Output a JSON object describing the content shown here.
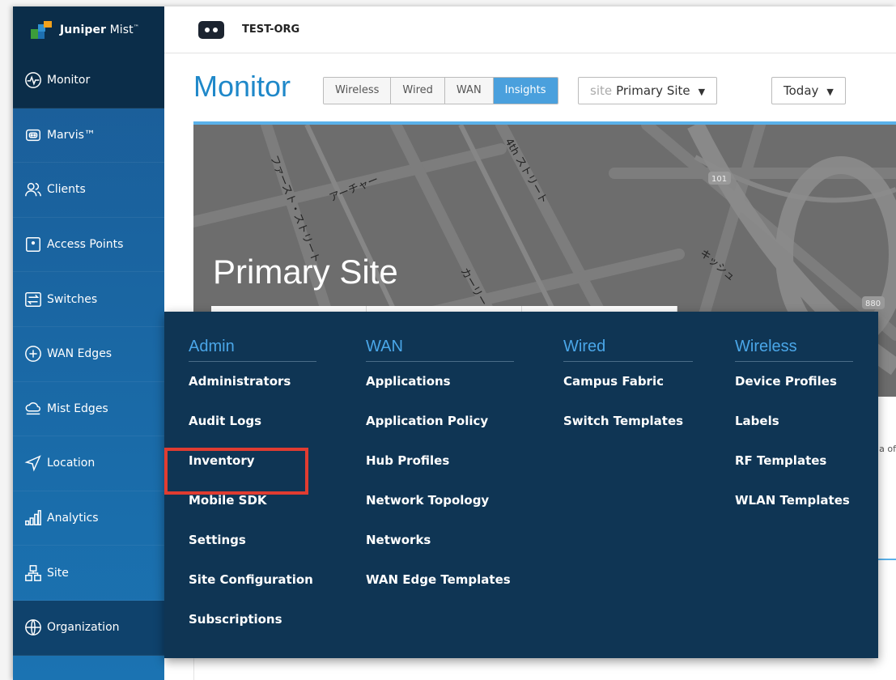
{
  "brand": {
    "name_bold": "Juniper",
    "name_rest": " Mist",
    "trademark": "™"
  },
  "org": {
    "name": "TEST-ORG"
  },
  "sidebar": {
    "items": [
      {
        "label": "Monitor",
        "icon": "pulse-icon",
        "active": true
      },
      {
        "label": "Marvis™",
        "icon": "marvis-icon"
      },
      {
        "label": "Clients",
        "icon": "users-icon"
      },
      {
        "label": "Access Points",
        "icon": "access-point-icon"
      },
      {
        "label": "Switches",
        "icon": "switch-icon"
      },
      {
        "label": "WAN Edges",
        "icon": "plus-circle-icon"
      },
      {
        "label": "Mist Edges",
        "icon": "cloud-icon"
      },
      {
        "label": "Location",
        "icon": "location-arrow-icon"
      },
      {
        "label": "Analytics",
        "icon": "bar-chart-icon"
      },
      {
        "label": "Site",
        "icon": "site-icon"
      },
      {
        "label": "Organization",
        "icon": "globe-icon"
      }
    ]
  },
  "header": {
    "title": "Monitor",
    "tabs": [
      {
        "label": "Wireless",
        "active": false
      },
      {
        "label": "Wired",
        "active": false
      },
      {
        "label": "WAN",
        "active": false
      },
      {
        "label": "Insights",
        "active": true
      }
    ],
    "site_selector": {
      "prefix": "site",
      "value": "Primary Site"
    },
    "time_selector": {
      "value": "Today"
    }
  },
  "map": {
    "site_name": "Primary Site",
    "road_labels": [
      "ファースト・ストリート",
      "アーチャー",
      "4th ストリート",
      "カーリー",
      "キッシュ",
      "101",
      "880"
    ]
  },
  "content": {
    "peek_text": "a of"
  },
  "menu": {
    "columns": [
      {
        "heading": "Admin",
        "items": [
          "Administrators",
          "Audit Logs",
          "Inventory",
          "Mobile SDK",
          "Settings",
          "Site Configuration",
          "Subscriptions"
        ]
      },
      {
        "heading": "WAN",
        "items": [
          "Applications",
          "Application Policy",
          "Hub Profiles",
          "Network Topology",
          "Networks",
          "WAN Edge Templates"
        ]
      },
      {
        "heading": "Wired",
        "items": [
          "Campus Fabric",
          "Switch Templates"
        ]
      },
      {
        "heading": "Wireless",
        "items": [
          "Device Profiles",
          "Labels",
          "RF Templates",
          "WLAN Templates"
        ]
      }
    ]
  },
  "colors": {
    "accent": "#1f88c9",
    "active_tab": "#4aa0dd",
    "menu_bg": "#0f3554",
    "menu_heading": "#4aa6e8",
    "highlight": "#e03c31",
    "sidebar_active": "#0b2d49"
  }
}
